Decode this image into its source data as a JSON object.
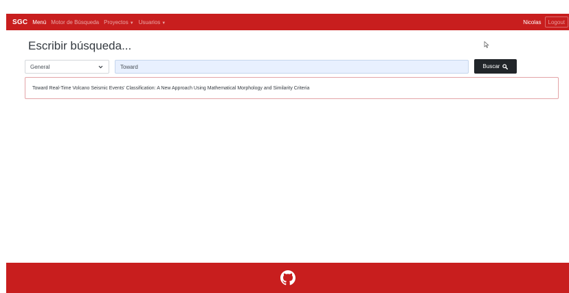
{
  "navbar": {
    "brand": "SGC",
    "items": [
      {
        "label": "Menú"
      },
      {
        "label": "Motor de Búsqueda"
      },
      {
        "label": "Proyectos"
      },
      {
        "label": "Usuarios"
      }
    ],
    "user": "Nicolas",
    "logout": "Logout"
  },
  "main": {
    "title": "Escribir búsqueda...",
    "filter_select": {
      "value": "General"
    },
    "search_input": {
      "value": "Toward"
    },
    "search_button": "Buscar",
    "results": [
      {
        "title": "Toward Real-Time Volcano Seismic Events' Classification: A New Approach Using Mathematical Morphology and Similarity Criteria"
      }
    ]
  },
  "footer": {
    "icon": "github-icon"
  },
  "colors": {
    "brand": "#c81e1e",
    "button": "#212529",
    "input_bg": "#e8f0fe"
  }
}
